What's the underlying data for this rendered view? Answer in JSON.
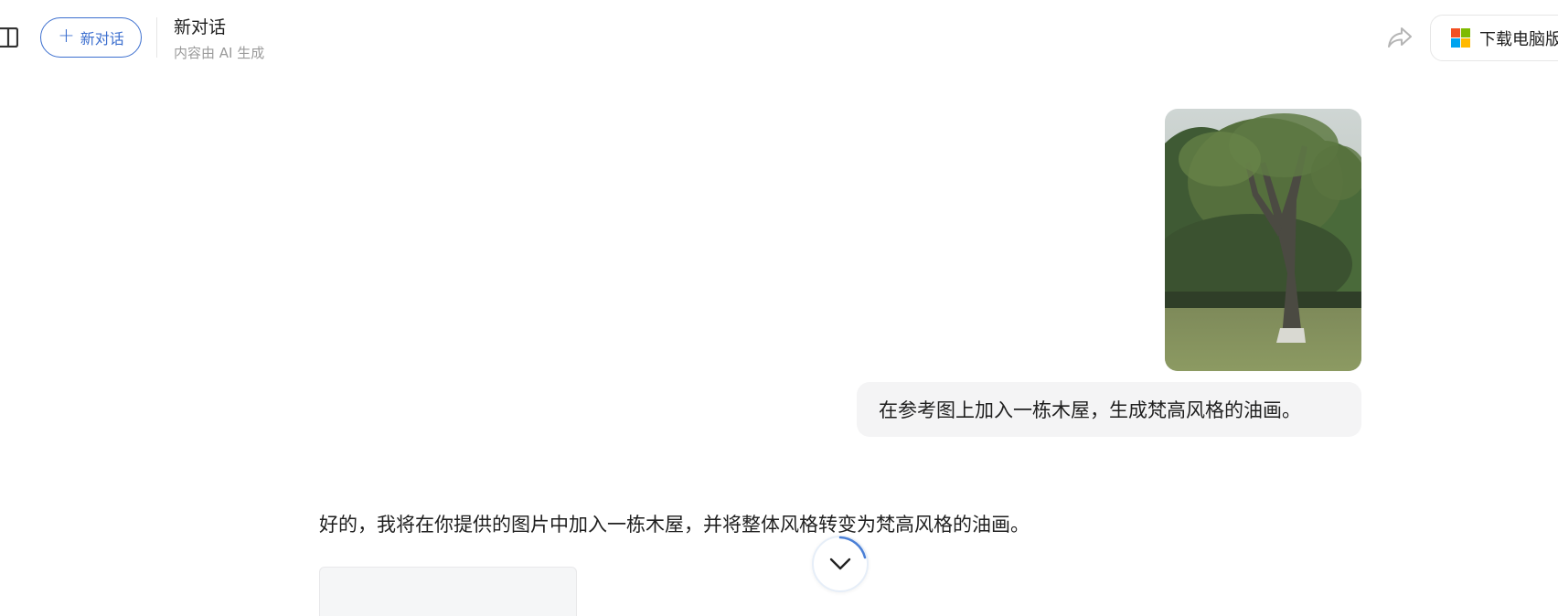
{
  "header": {
    "new_chat_label": "新对话",
    "title": "新对话",
    "subtitle": "内容由 AI 生成",
    "download_label": "下载电脑版"
  },
  "conversation": {
    "user_message": "在参考图上加入一栋木屋，生成梵高风格的油画。",
    "assistant_message": "好的，我将在你提供的图片中加入一栋木屋，并将整体风格转变为梵高风格的油画。"
  },
  "colors": {
    "accent": "#3c6fcf",
    "bubble_bg": "#f4f4f5",
    "ms_red": "#f25022",
    "ms_green": "#7fba00",
    "ms_blue": "#00a4ef",
    "ms_yellow": "#ffb900"
  },
  "icons": {
    "sidebar": "sidebar-toggle-icon",
    "share": "share-icon",
    "scroll": "chevron-down-icon",
    "brand": "microsoft-logo-icon"
  }
}
